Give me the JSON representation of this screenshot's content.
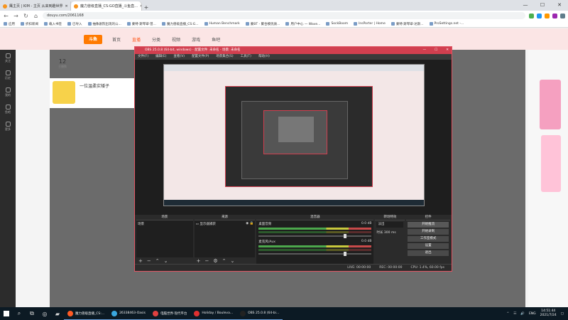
{
  "browser": {
    "tabs": [
      {
        "label": "鹰主页 | KIM - 主页 从来到趣世界",
        "active": false
      },
      {
        "label": "魔力兽级直播_CS:GO直播_斗鱼直...",
        "active": true
      }
    ],
    "new_tab": "+",
    "window_controls": [
      "—",
      "☐",
      "✕"
    ],
    "url": "douyu.com/2061168",
    "bookmarks": [
      "应用",
      "折扣新闻",
      "载入书签",
      "已导入",
      "抽象剧院出现的公...",
      "蒙特·斯琴翠·曾...",
      "魔力兽级直播_CS:G...",
      "Human Benchmark",
      "蒙BT - 聚合模优质...",
      "用户中心 — Wave...",
      "SockBoom",
      "InsPorter | Home",
      "蒙特·斯琴翠·达斯...",
      "ProSettings.net -..."
    ]
  },
  "site": {
    "logo": "斗鱼",
    "nav": [
      "首页",
      "直播",
      "分类",
      "视频",
      "游戏",
      "鱼吧"
    ],
    "rail": [
      "关注",
      "历史",
      "我的",
      "鱼吧",
      "更多"
    ],
    "stats": {
      "value": "12",
      "label": "主播数"
    },
    "anchor_name": "一位温柔实矮子"
  },
  "obs": {
    "title": "OBS 25.0.8 (64-bit, windows) - 配置文件: 未命名 - 场景: 未命名",
    "menu": [
      "文件(F)",
      "编辑(E)",
      "查看(V)",
      "配置文件(P)",
      "场景集合(S)",
      "工具(T)",
      "帮助(H)"
    ],
    "docks": {
      "scenes": {
        "title": "场景",
        "items": [
          "场景"
        ]
      },
      "sources": {
        "title": "来源",
        "items": [
          "显示器捕获"
        ]
      },
      "mixer": {
        "title": "混音器",
        "channels": [
          {
            "name": "桌面音频",
            "db": "0.0 dB"
          },
          {
            "name": "麦克风/Aux",
            "db": "0.0 dB"
          }
        ]
      },
      "transitions": {
        "title": "转场特效",
        "type": "淡出",
        "duration_label": "时长",
        "duration": "300 ms"
      },
      "controls": {
        "title": "控件",
        "buttons": [
          "开始推流",
          "开始录制",
          "工作室模式",
          "设置",
          "退出"
        ]
      }
    },
    "status": [
      "LIVE: 00:00:00",
      "REC: 00:00:00",
      "CPU: 1.4%, 60.00 fps"
    ]
  },
  "taskbar": {
    "apps": [
      {
        "label": "魔力兽级直播_CS:...",
        "color": "#ff5a24"
      },
      {
        "label": "26338463-Oasis",
        "color": "#3aa8e0"
      },
      {
        "label": "电脑世界·现代平台",
        "color": "#e04040"
      },
      {
        "label": "Holiday / Bouleva...",
        "color": "#e03030"
      },
      {
        "label": "OBS 25.0.8 (64-bi...",
        "color": "#222"
      }
    ],
    "lang": "ENG",
    "time": "14:51:44",
    "date": "2021/7/24"
  }
}
